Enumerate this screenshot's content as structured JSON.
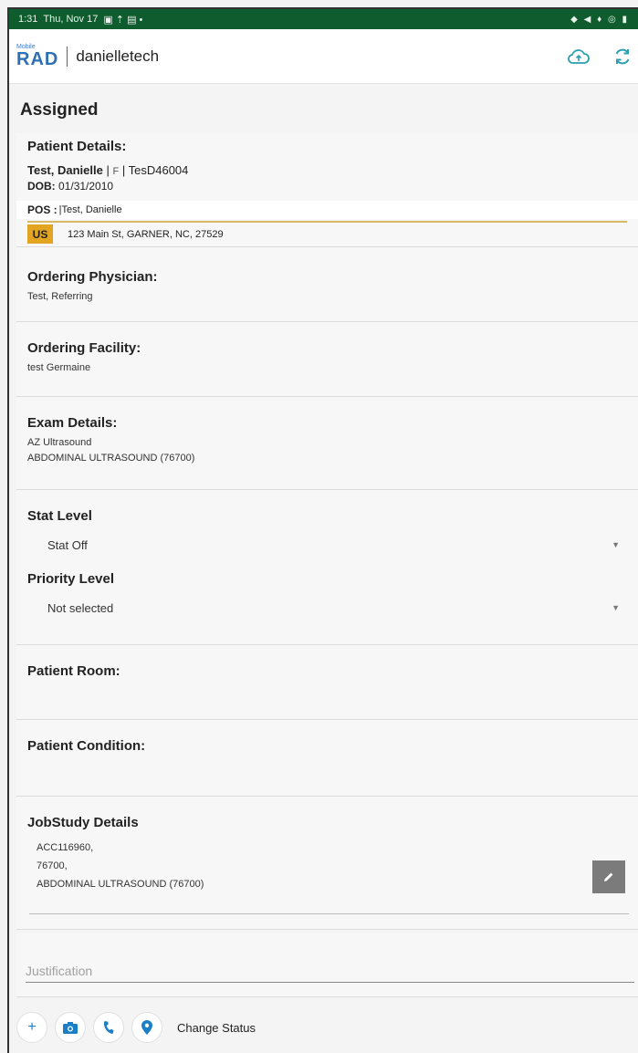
{
  "status_bar": {
    "time": "1:31",
    "date": "Thu, Nov 17",
    "indicators": "◆ ◀ ♦ ◎ ▮"
  },
  "app_bar": {
    "logo_small": "Mobile",
    "logo_big": "RAD",
    "technician": "danielletech",
    "actions": [
      "cloud-upload-icon",
      "refresh-icon"
    ]
  },
  "page": {
    "title": "Assigned"
  },
  "patient": {
    "section_title": "Patient Details:",
    "name": "Test, Danielle",
    "sep1": "|",
    "sex": "F",
    "sep2": "|",
    "id": "TesD46004",
    "dob_label": "DOB:",
    "dob": "01/31/2010",
    "pos_label": "POS :",
    "pos_sep": "|",
    "pos_value": "Test, Danielle",
    "country": "US",
    "address": "123 Main St, GARNER, NC, 27529"
  },
  "ordering_physician": {
    "title": "Ordering Physician:",
    "value": "Test, Referring"
  },
  "ordering_facility": {
    "title": "Ordering Facility:",
    "value": "test Germaine"
  },
  "exam": {
    "title": "Exam Details:",
    "modality": "AZ Ultrasound",
    "procedure": "ABDOMINAL ULTRASOUND (76700)"
  },
  "stat_level": {
    "title": "Stat Level",
    "selected": "Stat Off"
  },
  "priority_level": {
    "title": "Priority Level",
    "selected": "Not selected"
  },
  "patient_room": {
    "title": "Patient Room:"
  },
  "patient_condition": {
    "title": "Patient Condition:"
  },
  "jobstudy": {
    "title": "JobStudy Details",
    "accession": "ACC116960,",
    "code": "76700,",
    "procedure": "ABDOMINAL ULTRASOUND (76700)"
  },
  "justification": {
    "placeholder": "Justification"
  },
  "bottom_bar": {
    "add_label": "+",
    "change_status_label": "Change Status"
  },
  "colors": {
    "status_bar": "#0f5c2e",
    "accent_blue": "#1a7fc4",
    "cloud_teal": "#2a9fb0",
    "us_badge": "#e3a521",
    "gold_line": "#d9b865"
  }
}
